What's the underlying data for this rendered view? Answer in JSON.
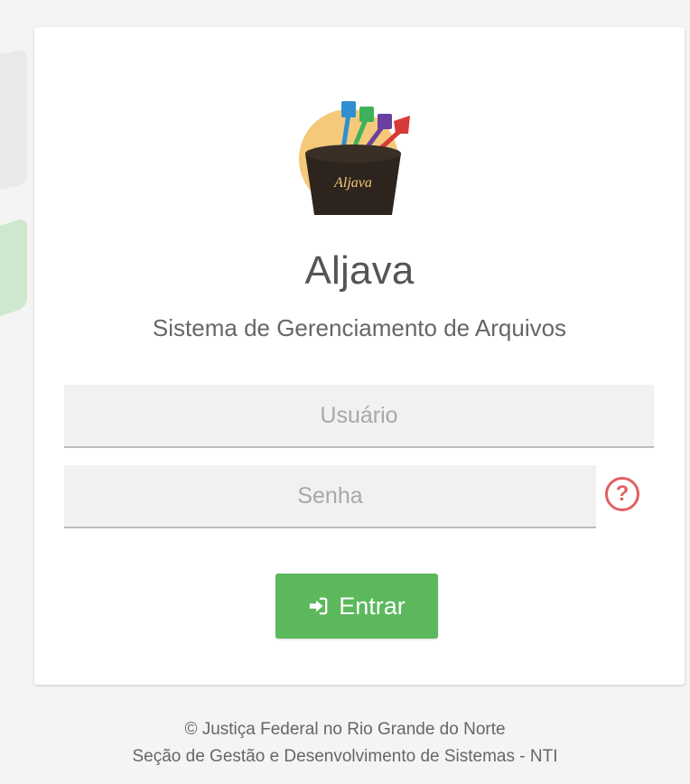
{
  "app": {
    "title": "Aljava",
    "subtitle": "Sistema de Gerenciamento de Arquivos",
    "logo_text": "Aljava"
  },
  "form": {
    "username": {
      "placeholder": "Usuário",
      "value": ""
    },
    "password": {
      "placeholder": "Senha",
      "value": ""
    },
    "help_icon": "?",
    "login_button": "Entrar",
    "login_icon": "sign-in-icon"
  },
  "footer": {
    "line1": "© Justiça Federal no Rio Grande do Norte",
    "line2": "Seção de Gestão e Desenvolvimento de Sistemas - NTI"
  },
  "colors": {
    "accent_green": "#5cb85c",
    "help_red": "#e06161"
  }
}
